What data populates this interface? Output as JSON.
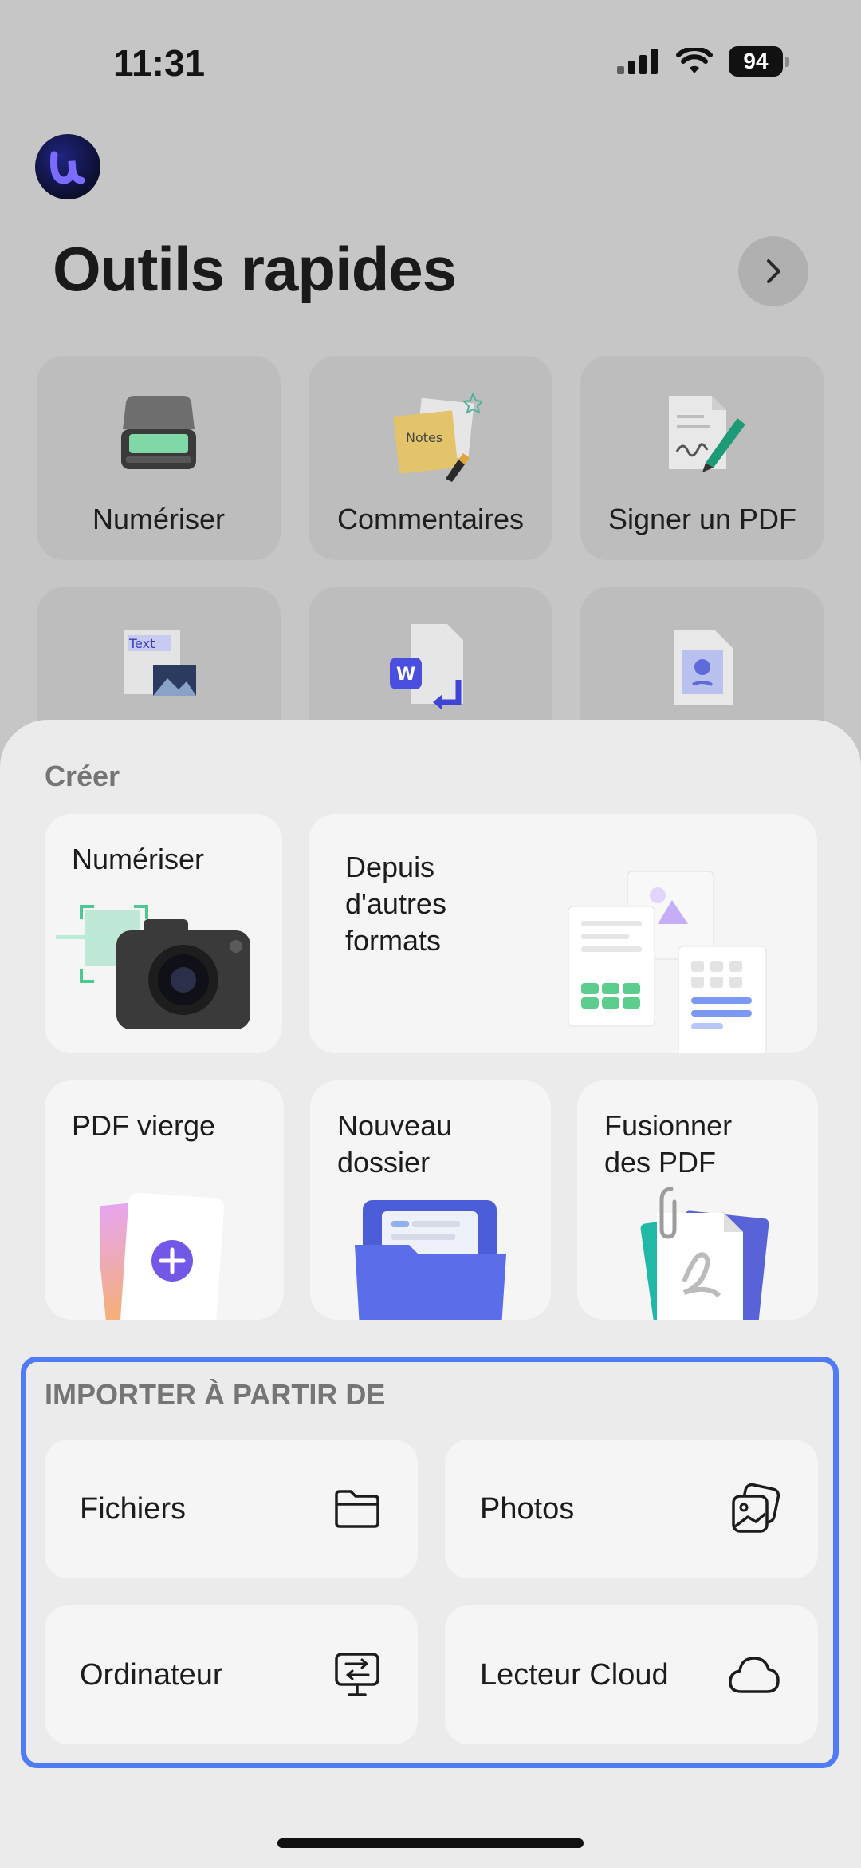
{
  "status_bar": {
    "time": "11:31",
    "battery": "94"
  },
  "header": {
    "title": "Outils rapides"
  },
  "quick_tools": [
    {
      "label": "Numériser",
      "icon": "scanner-icon"
    },
    {
      "label": "Commentaires",
      "icon": "notes-icon"
    },
    {
      "label": "Signer un PDF",
      "icon": "signature-icon"
    },
    {
      "label": "",
      "icon": "text-image-icon"
    },
    {
      "label": "",
      "icon": "word-convert-icon"
    },
    {
      "label": "",
      "icon": "image-file-icon"
    }
  ],
  "create": {
    "title": "Créer",
    "scan_label": "Numériser",
    "formats_label": "Depuis\nd'autres\nformats",
    "blank_label": "PDF vierge",
    "folder_label": "Nouveau\ndossier",
    "merge_label": "Fusionner\ndes PDF"
  },
  "import": {
    "title": "IMPORTER À PARTIR DE",
    "items": [
      {
        "label": "Fichiers",
        "icon": "folder-icon"
      },
      {
        "label": "Photos",
        "icon": "photos-icon"
      },
      {
        "label": "Ordinateur",
        "icon": "computer-transfer-icon"
      },
      {
        "label": "Lecteur Cloud",
        "icon": "cloud-icon"
      }
    ]
  },
  "colors": {
    "accent": "#4f7cf6",
    "sheet": "#ebebeb",
    "card": "#f5f5f5"
  }
}
